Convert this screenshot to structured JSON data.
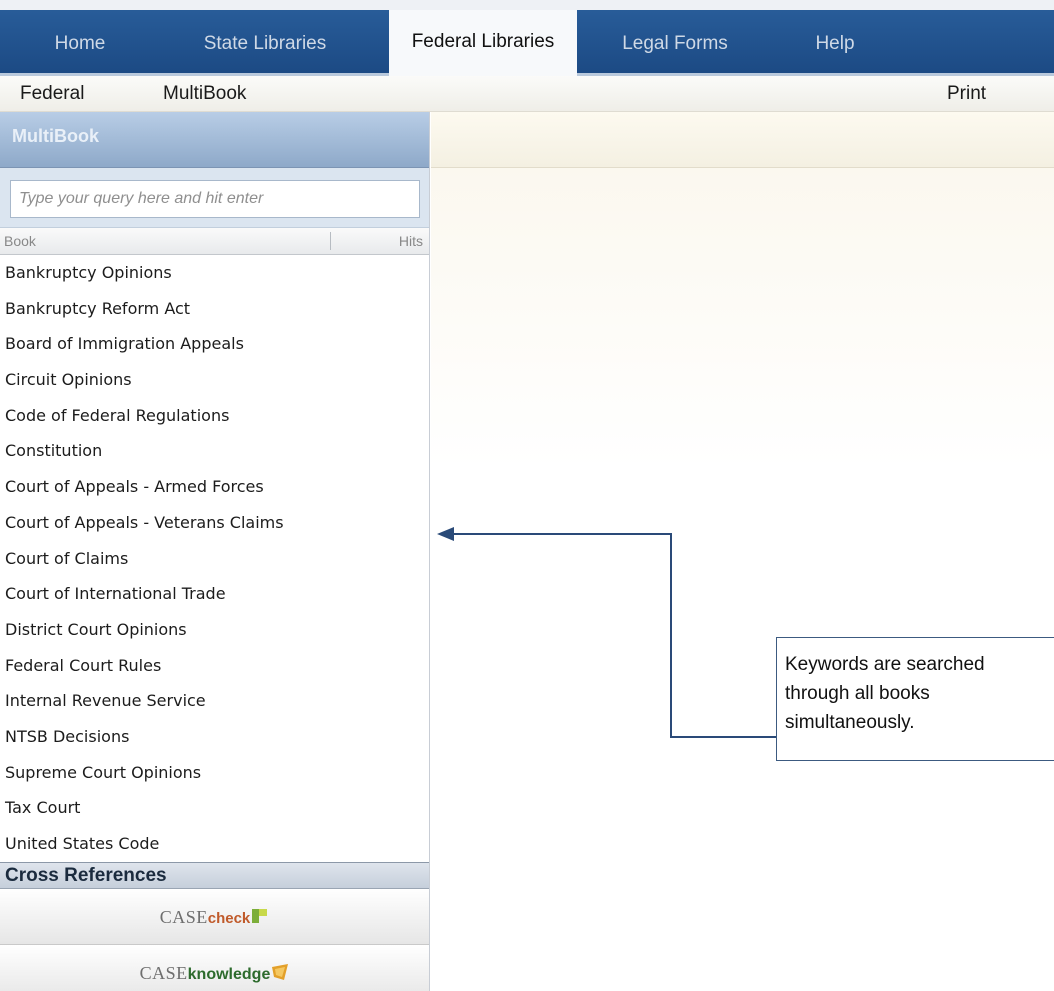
{
  "top_tabs": [
    {
      "label": "Home",
      "active": false
    },
    {
      "label": "State Libraries",
      "active": false
    },
    {
      "label": "Federal Libraries",
      "active": true
    },
    {
      "label": "Legal Forms",
      "active": false
    },
    {
      "label": "Help",
      "active": false
    }
  ],
  "sub_nav": {
    "federal": "Federal",
    "multibook": "MultiBook",
    "print": "Print"
  },
  "panel": {
    "title": "MultiBook",
    "search_placeholder": "Type your query here and hit enter",
    "col_book": "Book",
    "col_hits": "Hits",
    "books": [
      "Bankruptcy Opinions",
      "Bankruptcy Reform Act",
      "Board of Immigration Appeals",
      "Circuit Opinions",
      "Code of Federal Regulations",
      "Constitution",
      "Court of Appeals - Armed Forces",
      "Court of Appeals - Veterans Claims",
      "Court of Claims",
      "Court of International Trade",
      "District Court Opinions",
      "Federal Court Rules",
      "Internal Revenue Service",
      "NTSB Decisions",
      "Supreme Court Opinions",
      "Tax Court",
      "United States Code"
    ],
    "cross_references": "Cross References",
    "casecheck": {
      "prefix": "CASE",
      "suffix": "check"
    },
    "caseknowledge": {
      "prefix": "CASE",
      "suffix": "knowledge"
    }
  },
  "callout": {
    "text": "Keywords are searched through all books simultaneously."
  },
  "colors": {
    "nav_blue": "#1c4a84",
    "callout_line": "#2a4a78"
  }
}
